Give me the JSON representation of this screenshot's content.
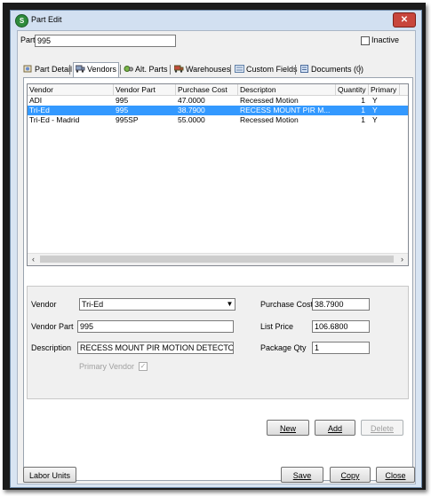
{
  "window": {
    "title": "Part Edit",
    "close_glyph": "✕",
    "app_icon": "S"
  },
  "part": {
    "label": "Part",
    "value": "995",
    "inactive_label": "Inactive",
    "inactive_checked": false
  },
  "tabs": [
    {
      "label": "Part Detail",
      "icon": "part-detail-icon",
      "active": false
    },
    {
      "label": "Vendors",
      "icon": "truck-icon",
      "active": true
    },
    {
      "label": "Alt. Parts",
      "icon": "gears-icon",
      "active": false
    },
    {
      "label": "Warehouses",
      "icon": "warehouse-truck-icon",
      "active": false
    },
    {
      "label": "Custom Fields",
      "icon": "custom-fields-icon",
      "active": false
    },
    {
      "label": "Documents (0)",
      "icon": "document-icon",
      "active": false
    }
  ],
  "grid": {
    "columns": [
      "Vendor",
      "Vendor Part",
      "Purchase Cost",
      "Descripton",
      "Quantity",
      "Primary"
    ],
    "rows": [
      [
        "ADI",
        "995",
        "47.0000",
        "Recessed Motion",
        "1",
        "Y"
      ],
      [
        "Tri-Ed",
        "995",
        "38.7900",
        "RECESS MOUNT PIR M...",
        "1",
        "Y"
      ],
      [
        "Tri-Ed - Madrid",
        "995SP",
        "55.0000",
        "Recessed Motion",
        "1",
        "Y"
      ]
    ],
    "selected_row": 1,
    "scroll_left": "‹",
    "scroll_right": "›"
  },
  "form": {
    "vendor_label": "Vendor",
    "vendor_value": "Tri-Ed",
    "vendor_part_label": "Vendor Part",
    "vendor_part_value": "995",
    "description_label": "Description",
    "description_value": "RECESS MOUNT PIR MOTION DETECTOR",
    "primary_vendor_label": "Primary Vendor",
    "primary_vendor_checked": true,
    "purchase_cost_label": "Purchase Cost",
    "purchase_cost_value": "38.7900",
    "list_price_label": "List Price",
    "list_price_value": "106.6800",
    "package_qty_label": "Package Qty",
    "package_qty_value": "1",
    "dropdown_glyph": "▼",
    "check_glyph": "✓"
  },
  "actions": {
    "new": "New",
    "add": "Add",
    "delete": "Delete"
  },
  "footer": {
    "labor_units": "Labor Units",
    "save": "Save",
    "copy": "Copy",
    "close": "Close"
  }
}
